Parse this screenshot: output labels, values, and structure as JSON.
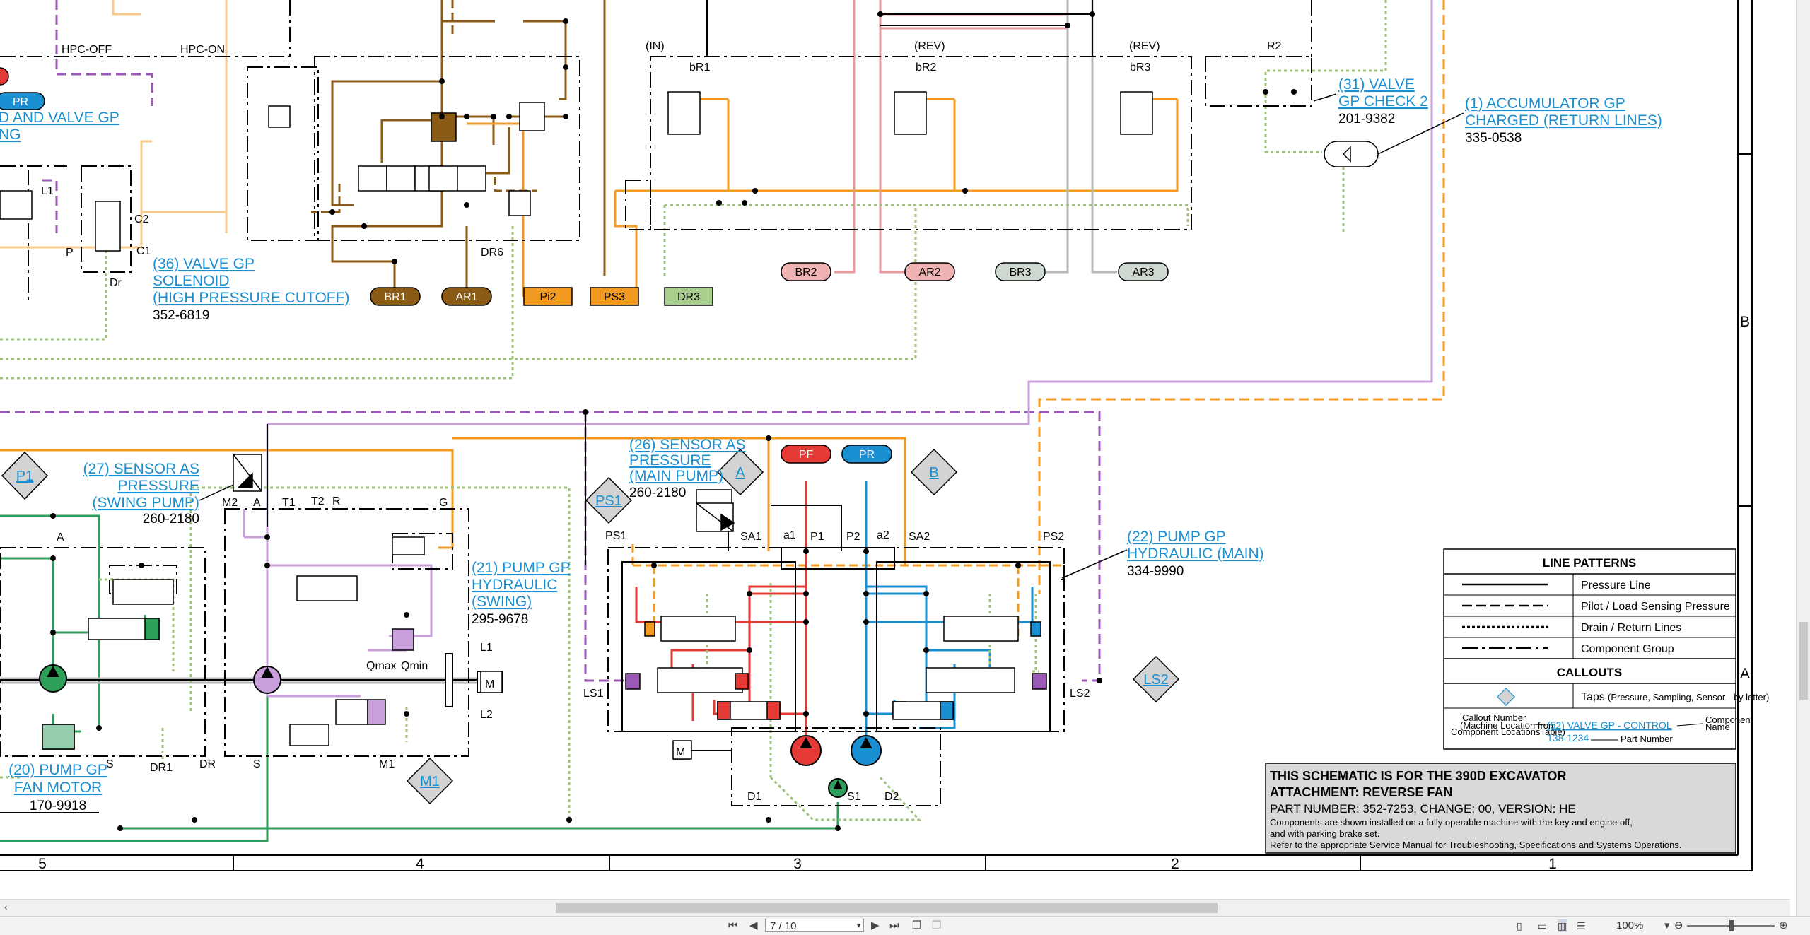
{
  "sheet": {
    "top_labels": [
      "HPC-OFF",
      "HPC-ON",
      "(IN)",
      "(REV)",
      "(REV)",
      "R2"
    ],
    "valve_labels": [
      "bR1",
      "bR2",
      "bR3"
    ],
    "port_pills": [
      {
        "text": "PR",
        "color": "#1a8fd1",
        "text_color": "#ffffff"
      },
      {
        "text": "BR1",
        "color": "#8b5a14",
        "text_color": "#ffffff"
      },
      {
        "text": "AR1",
        "color": "#8b5a14",
        "text_color": "#ffffff"
      },
      {
        "text": "Pi2",
        "color": "#f39a22",
        "text_color": "#000000"
      },
      {
        "text": "PS3",
        "color": "#f39a22",
        "text_color": "#000000"
      },
      {
        "text": "DR3",
        "color": "#a9cf8f",
        "text_color": "#000000"
      },
      {
        "text": "BR2",
        "color": "#f0b3b3",
        "text_color": "#000000"
      },
      {
        "text": "AR2",
        "color": "#f0b3b3",
        "text_color": "#000000"
      },
      {
        "text": "BR3",
        "color": "#cfd8d0",
        "text_color": "#000000"
      },
      {
        "text": "AR3",
        "color": "#cfd8d0",
        "text_color": "#000000"
      },
      {
        "text": "PF",
        "color": "#e53935",
        "text_color": "#ffffff"
      },
      {
        "text": "PR",
        "color": "#1a8fd1",
        "text_color": "#ffffff"
      }
    ],
    "callouts": {
      "c31": {
        "l1": "(31) VALVE",
        "l2": "GP CHECK 2",
        "pn": "201-9382"
      },
      "c1": {
        "l1": "(1) ACCUMULATOR GP",
        "l2": "CHARGED (RETURN LINES)",
        "pn": "335-0538"
      },
      "c36": {
        "l1": "(36) VALVE GP",
        "l2": "SOLENOID",
        "l3": "(HIGH PRESSURE CUTOFF)",
        "pn": "352-6819"
      },
      "cleft": {
        "l1": "D AND VALVE GP",
        "l2": "NG"
      },
      "c27": {
        "l1": "(27) SENSOR AS",
        "l2": "PRESSURE",
        "l3": "(SWING PUMP)",
        "pn": "260-2180"
      },
      "c26": {
        "l1": "(26) SENSOR AS",
        "l2": "PRESSURE",
        "l3": "(MAIN PUMP)",
        "pn": "260-2180"
      },
      "c21": {
        "l1": "(21) PUMP GP",
        "l2": "HYDRAULIC",
        "l3": "(SWING)",
        "pn": "295-9678"
      },
      "c22": {
        "l1": "(22) PUMP GP",
        "l2": "HYDRAULIC (MAIN)",
        "pn": "334-9990"
      },
      "c20": {
        "l1": "(20) PUMP GP",
        "l2": "FAN MOTOR",
        "pn": "170-9918"
      }
    },
    "taps": [
      "P1",
      "A",
      "B",
      "PS1",
      "M1",
      "LS2"
    ],
    "small_labels": {
      "m2": "M2",
      "a": "A",
      "t1": "T1",
      "t2": "T2",
      "r": "R",
      "g": "G",
      "l1": "L1",
      "l2": "L2",
      "qmax": "Qmax",
      "qmin": "Qmin",
      "s": "S",
      "m1": "M1",
      "dr1": "DR1",
      "dr": "DR",
      "ps1": "PS1",
      "sa1": "SA1",
      "a1": "a1",
      "p1": "P1",
      "p2": "P2",
      "a2": "a2",
      "sa2": "SA2",
      "ps2": "PS2",
      "ls1": "LS1",
      "ls2": "LS2",
      "d1": "D1",
      "s1": "S1",
      "d2": "D2",
      "l1b": "L1",
      "c2": "C2",
      "c1": "C1",
      "p": "P",
      "dr2": "Dr",
      "dr6": "DR6",
      "s2": "S",
      "a3": "A"
    },
    "zones_bottom": [
      "5",
      "4",
      "3",
      "2",
      "1"
    ],
    "zones_right": [
      "B",
      "A"
    ],
    "legend": {
      "title": "LINE PATTERNS",
      "rows": [
        "Pressure Line",
        "Pilot / Load Sensing Pressure",
        "Drain / Return Lines",
        "Component Group"
      ],
      "callouts_title": "CALLOUTS",
      "taps_label": "Taps",
      "taps_sub": "(Pressure, Sampling, Sensor - by letter)",
      "callout_number": "Callout Number",
      "callout_number_sub1": "(Machine Location from",
      "callout_number_sub2": "Component LocationsTable)",
      "example_callout": "(52) VALVE GP - CONTROL",
      "example_pn": "138-1234",
      "component_name": "Component",
      "component_name2": "Name",
      "part_number": "Part Number"
    },
    "title_block": {
      "line1": "THIS SCHEMATIC IS FOR THE 390D EXCAVATOR",
      "line2": "ATTACHMENT: REVERSE FAN",
      "line3": "PART NUMBER: 352-7253, CHANGE: 00, VERSION: HE",
      "line4": "Components are shown installed on a fully operable machine with the key and engine off,",
      "line5": "and with parking brake set.",
      "line6": "Refer to the appropriate Service Manual for Troubleshooting, Specifications and Systems Operations."
    }
  },
  "viewer": {
    "page_field": "7 / 10",
    "zoom": "100%"
  },
  "colors": {
    "brown": "#8b5a14",
    "orange": "#f39a22",
    "green": "#2e9e5b",
    "purple": "#9b59b6",
    "lavender": "#c9a0dc",
    "pink": "#e89aa0",
    "gray": "#b8b8b8",
    "red": "#e53935",
    "blue": "#1a8fd1",
    "drain": "#9cc27a",
    "peach": "#f8c98a"
  }
}
